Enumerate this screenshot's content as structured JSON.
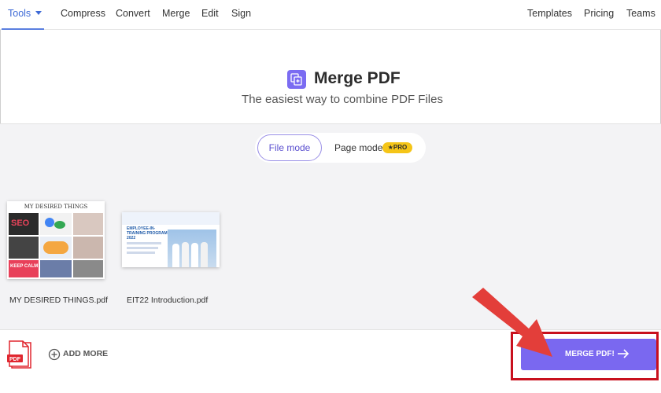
{
  "nav": {
    "tools": "Tools",
    "left_items": [
      "Compress",
      "Convert",
      "Merge",
      "Edit",
      "Sign"
    ],
    "right_items": [
      "Templates",
      "Pricing",
      "Teams"
    ]
  },
  "hero": {
    "icon": "merge-pdf-icon",
    "title": "Merge PDF",
    "subtitle": "The easiest way to combine PDF Files"
  },
  "modes": {
    "file_mode": "File mode",
    "page_mode": "Page mode",
    "pro_badge": "★PRO",
    "selected": "File mode"
  },
  "files": [
    {
      "name": "MY DESIRED THINGS.pdf",
      "thumb_heading": "MY DESIRED THINGS",
      "thumb_words": [
        "SEO",
        "KEEP CALM"
      ]
    },
    {
      "name": "EIT22 Introduction.pdf",
      "thumb_heading": "EMPLOYEE-IN-TRAINING PROGRAM 2022"
    }
  ],
  "footer": {
    "pdf_icon_text": "PDF",
    "add_more": "ADD MORE",
    "merge_button": "MERGE PDF!"
  },
  "colors": {
    "accent": "#7a68f0",
    "nav_active": "#3e6ad6",
    "pro_badge": "#f5c518",
    "annotation": "#c8101e",
    "pdf_red": "#e0262f"
  }
}
